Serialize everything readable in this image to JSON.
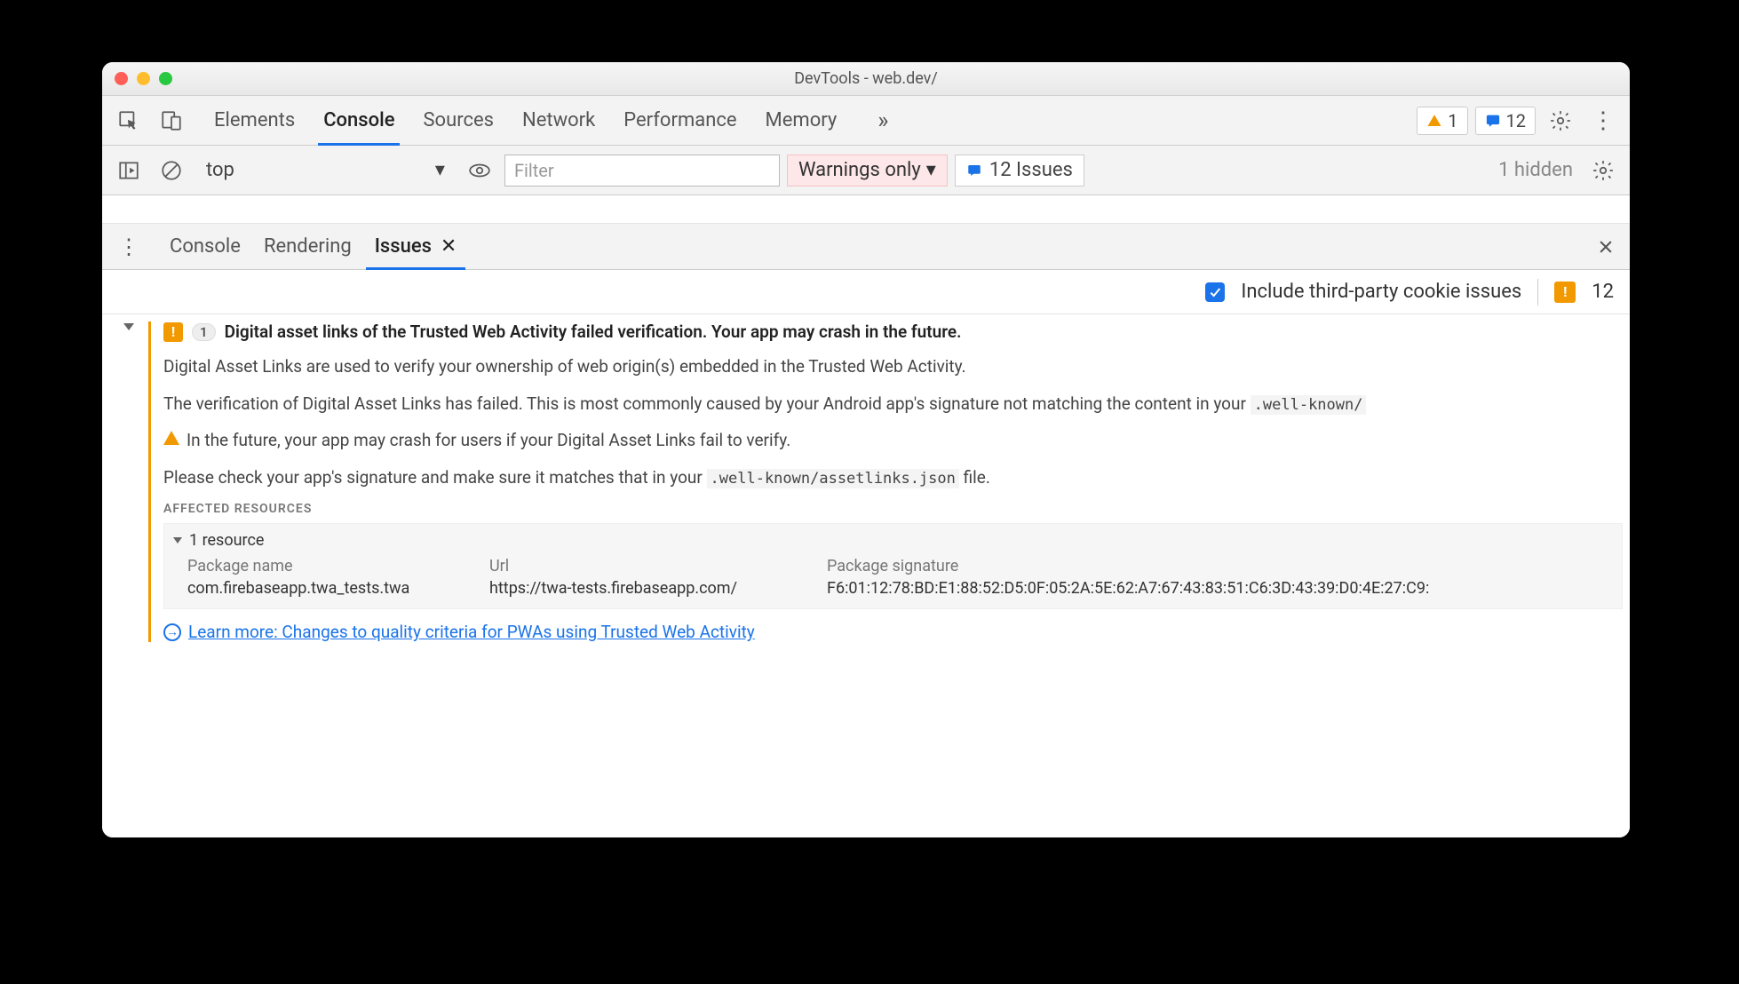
{
  "window": {
    "title": "DevTools - web.dev/"
  },
  "main_tabs": {
    "items": [
      "Elements",
      "Console",
      "Sources",
      "Network",
      "Performance",
      "Memory"
    ],
    "active": "Console",
    "warning_count": "1",
    "issues_count": "12"
  },
  "console_toolbar": {
    "context": "top",
    "filter_placeholder": "Filter",
    "level": "Warnings only",
    "issues_button": "12 Issues",
    "hidden_label": "1 hidden"
  },
  "drawer": {
    "tabs": [
      "Console",
      "Rendering",
      "Issues"
    ],
    "active": "Issues"
  },
  "issues_options": {
    "checkbox_label": "Include third-party cookie issues",
    "total": "12"
  },
  "issue": {
    "count": "1",
    "title": "Digital asset links of the Trusted Web Activity failed verification. Your app may crash in the future.",
    "p1": "Digital Asset Links are used to verify your ownership of web origin(s) embedded in the Trusted Web Activity.",
    "p2_a": "The verification of Digital Asset Links has failed. This is most commonly caused by your Android app's signature not matching the content in your ",
    "p2_code": ".well-known/",
    "p3": "In the future, your app may crash for users if your Digital Asset Links fail to verify.",
    "p4_a": "Please check your app's signature and make sure it matches that in your ",
    "p4_code": ".well-known/assetlinks.json",
    "p4_b": " file.",
    "resources_label": "AFFECTED RESOURCES",
    "resources_toggle": "1 resource",
    "table": {
      "headers": [
        "Package name",
        "Url",
        "Package signature"
      ],
      "row": {
        "pkg": "com.firebaseapp.twa_tests.twa",
        "url": "https://twa-tests.firebaseapp.com/",
        "sig": "F6:01:12:78:BD:E1:88:52:D5:0F:05:2A:5E:62:A7:67:43:83:51:C6:3D:43:39:D0:4E:27:C9:"
      }
    },
    "learn_more": "Learn more: Changes to quality criteria for PWAs using Trusted Web Activity"
  }
}
